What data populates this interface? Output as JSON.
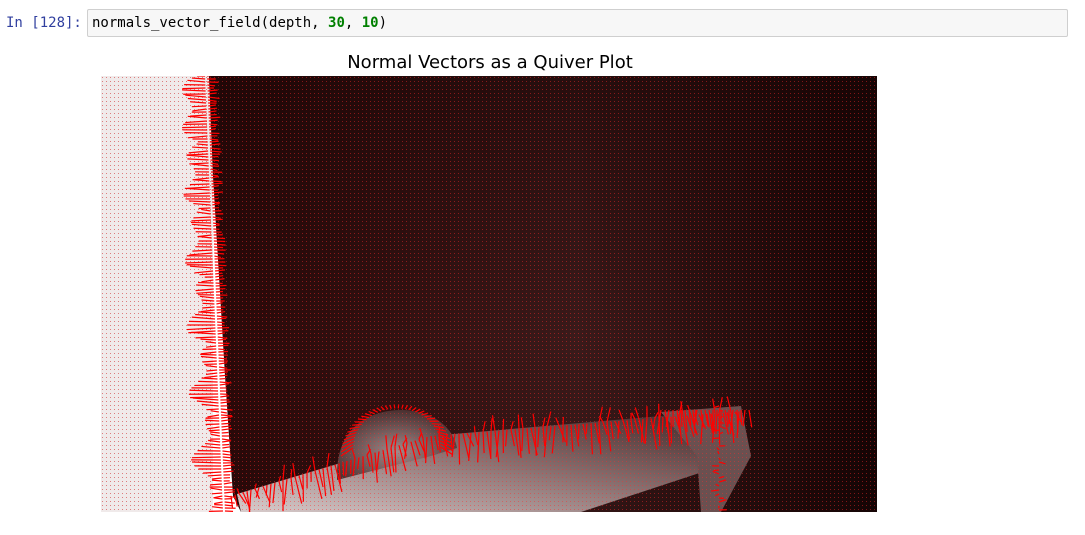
{
  "cell": {
    "prompt": "In [128]:",
    "code": {
      "func": "normals_vector_field",
      "open": "(",
      "arg1": "depth",
      "sep1": ", ",
      "arg2": "30",
      "sep2": ", ",
      "arg3": "10",
      "close": ")"
    }
  },
  "output": {
    "title": "Normal Vectors as a Quiver Plot",
    "arrow_color": "#ff0000",
    "background_far_color": "#1a0606",
    "background_near_color": "#eeeeee"
  }
}
